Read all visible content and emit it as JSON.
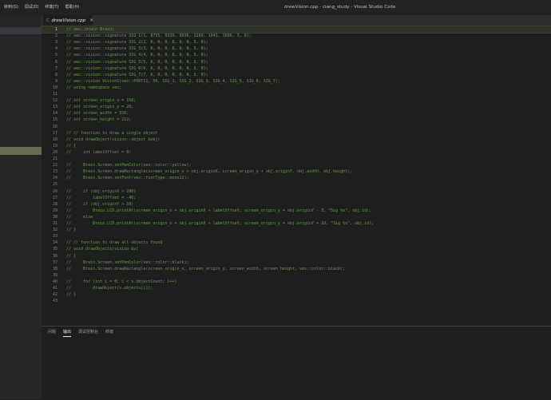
{
  "window": {
    "title": "drewVision.cpp - clang_study - Visual Studio Code"
  },
  "menu": {
    "items": [
      "转到(G)",
      "调试(D)",
      "终端(T)",
      "帮助(H)"
    ]
  },
  "tab": {
    "label": "drewVision.cpp",
    "close": "×"
  },
  "editor": {
    "current_line": 1,
    "lines": [
      "// vex::brain Brain;",
      "// vex::vision::signature SIG_1(1, 8755, 9319, 9036, 1269, 1943, 1606, 3, 0);",
      "// vex::vision::signature SIG_2(2, 0, 0, 0, 0, 0, 0, 3, 0);",
      "// vex::vision::signature SIG_3(3, 0, 0, 0, 0, 0, 0, 3, 0);",
      "// vex::vision::signature SIG_4(4, 0, 0, 0, 0, 0, 0, 3, 0);",
      "// vex::vision::signature SIG_5(5, 0, 0, 0, 0, 0, 0, 3, 0);",
      "// vex::vision::signature SIG_6(6, 0, 0, 0, 0, 0, 0, 3, 0);",
      "// vex::vision::signature SIG_7(7, 0, 0, 0, 0, 0, 0, 3, 0);",
      "// vex::vision Vision1(vex::PORT11, 50, SIG_1, SIG_2, SIG_3, SIG_4, SIG_5, SIG_6, SIG_7);",
      "// using namespace vex;",
      "",
      "// int screen_origin_x = 150;",
      "// int screen_origin_y = 20;",
      "// int screen_width = 316;",
      "// int screen_height = 212;",
      "",
      "// // function to draw a single object",
      "// void drawObject(vision::object &obj)",
      "// {",
      "//     int labelOffset = 0;",
      "",
      "//     Brain.Screen.setPenColor(vex::color::yellow);",
      "//     Brain.Screen.drawRectangle(screen_origin_x + obj.originX, screen_origin_y + obj.originY, obj.width, obj.height);",
      "//     Brain.Screen.setFont(vex::fontType::mono12);",
      "",
      "//     if (obj.originX > 280)",
      "//         labelOffset = -40;",
      "//     if (obj.originY > 10)",
      "//         Brain.LCD.printAt(screen_origin_x + obj.originX + labelOffset, screen_origin_y + obj.originY - 3, \"Sig %o\", obj.id);",
      "//     else",
      "//         Brain.LCD.printAt(screen_origin_x + obj.originX + labelOffset, screen_origin_y + obj.originY + 10, \"Sig %o\", obj.id);",
      "// }",
      "",
      "// // function to draw all objects found",
      "// void drawObjects(vision &v)",
      "// {",
      "//     Brain.Screen.setPenColor(vex::color::black);",
      "//     Brain.Screen.drawRectangle(screen_origin_x, screen_origin_y, screen_width, screen_height, vex::color::black);",
      "",
      "//     for (int i = 0; i < v.objectCount; i++)",
      "//         drawObject(v.objects[i]);",
      "// }",
      ""
    ]
  },
  "panel": {
    "tabs": [
      "问题",
      "输出",
      "调试控制台",
      "终端"
    ],
    "active_index": 1
  },
  "colors": {
    "editor_bg": "#1e1e1e",
    "comment": "#6a9955",
    "line_number": "#858585",
    "tab_icon": "#d8548d"
  }
}
